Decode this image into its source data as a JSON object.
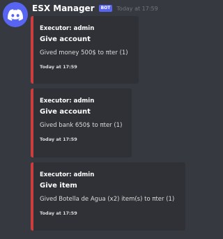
{
  "message": {
    "username": "ESX Manager",
    "bot_tag": "BOT",
    "timestamp": "Today at 17:59",
    "avatar_icon": "discord-logo-icon",
    "embed_color": "#cc3d3d"
  },
  "embeds": [
    {
      "author": "Executor: admin",
      "title": "Give account",
      "description": "Gived money 500$ to πter (1)",
      "footer": "Today at 17:59"
    },
    {
      "author": "Executor: admin",
      "title": "Give account",
      "description": "Gived bank 650$ to πter (1)",
      "footer": "Today at 17:59"
    },
    {
      "author": "Executor: admin",
      "title": "Give item",
      "description": "Gived Botella de Agua (x2) item(s) to πter (1)",
      "footer": "Today at 17:59"
    }
  ]
}
